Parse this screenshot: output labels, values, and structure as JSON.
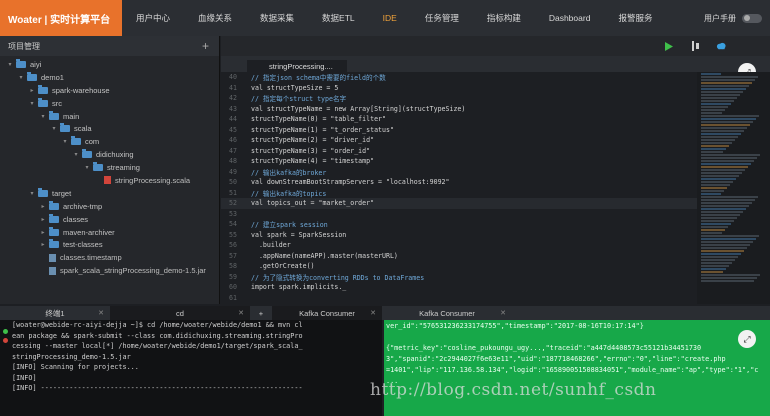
{
  "brand": "Woater | 实时计算平台",
  "nav": {
    "items": [
      "用户中心",
      "血缘关系",
      "数据采集",
      "数据ETL",
      "IDE",
      "任务管理",
      "指标构建",
      "Dashboard",
      "报警服务"
    ],
    "active": "IDE",
    "user_manual": "用户手册"
  },
  "sidebar": {
    "title": "项目管理",
    "add_icon": "plus-icon",
    "tree": [
      {
        "label": "aiyi",
        "depth": 0,
        "type": "folder",
        "caret": "▾"
      },
      {
        "label": "demo1",
        "depth": 1,
        "type": "folder",
        "caret": "▾"
      },
      {
        "label": "spark-warehouse",
        "depth": 2,
        "type": "folder",
        "caret": "▸"
      },
      {
        "label": "src",
        "depth": 2,
        "type": "folder",
        "caret": "▾"
      },
      {
        "label": "main",
        "depth": 3,
        "type": "folder",
        "caret": "▾"
      },
      {
        "label": "scala",
        "depth": 4,
        "type": "folder",
        "caret": "▾"
      },
      {
        "label": "com",
        "depth": 5,
        "type": "folder",
        "caret": "▾"
      },
      {
        "label": "didichuxing",
        "depth": 6,
        "type": "folder",
        "caret": "▾"
      },
      {
        "label": "streaming",
        "depth": 7,
        "type": "folder",
        "caret": "▾"
      },
      {
        "label": "stringProcessing.scala",
        "depth": 8,
        "type": "file-red",
        "caret": ""
      },
      {
        "label": "target",
        "depth": 2,
        "type": "folder",
        "caret": "▾"
      },
      {
        "label": "archive-tmp",
        "depth": 3,
        "type": "folder",
        "caret": "▸"
      },
      {
        "label": "classes",
        "depth": 3,
        "type": "folder",
        "caret": "▸"
      },
      {
        "label": "maven-archiver",
        "depth": 3,
        "type": "folder",
        "caret": "▸"
      },
      {
        "label": "test-classes",
        "depth": 3,
        "type": "folder",
        "caret": "▸"
      },
      {
        "label": "classes.timestamp",
        "depth": 3,
        "type": "file",
        "caret": ""
      },
      {
        "label": "spark_scala_stringProcessing_demo-1.5.jar",
        "depth": 3,
        "type": "file",
        "caret": ""
      }
    ]
  },
  "editor": {
    "tab_label": "stringProcessing....",
    "toolbar_icons": [
      "play-icon",
      "split-icon",
      "cloud-icon"
    ],
    "lines": [
      {
        "n": "40",
        "kind": "comment",
        "text": "// 指定json schema中需要的field的个数"
      },
      {
        "n": "41",
        "kind": "code",
        "text": "val structTypeSize = 5"
      },
      {
        "n": "42",
        "kind": "comment",
        "text": "// 指定每个struct type名字"
      },
      {
        "n": "43",
        "kind": "code",
        "text": "val structTypeName = new Array[String](structTypeSize)"
      },
      {
        "n": "44",
        "kind": "code",
        "text": "structTypeName(0) = \"table_filter\""
      },
      {
        "n": "45",
        "kind": "code",
        "text": "structTypeName(1) = \"t_order_status\""
      },
      {
        "n": "46",
        "kind": "code",
        "text": "structTypeName(2) = \"driver_id\""
      },
      {
        "n": "47",
        "kind": "code",
        "text": "structTypeName(3) = \"order_id\""
      },
      {
        "n": "48",
        "kind": "code",
        "text": "structTypeName(4) = \"timestamp\""
      },
      {
        "n": "49",
        "kind": "comment",
        "text": "// 输出kafka的broker"
      },
      {
        "n": "50",
        "kind": "code",
        "text": "val downStreamBootStrampServers = \"localhost:9092\""
      },
      {
        "n": "51",
        "kind": "comment",
        "text": "// 输出kafka的topics"
      },
      {
        "n": "52",
        "kind": "code",
        "text": "val topics_out = \"market_order\""
      },
      {
        "n": "53",
        "kind": "blank",
        "text": ""
      },
      {
        "n": "54",
        "kind": "comment",
        "text": "// 建立spark session"
      },
      {
        "n": "55",
        "kind": "code",
        "text": "val spark = SparkSession"
      },
      {
        "n": "56",
        "kind": "code",
        "text": "  .builder"
      },
      {
        "n": "57",
        "kind": "code",
        "text": "  .appName(nameAPP).master(masterURL)"
      },
      {
        "n": "58",
        "kind": "code",
        "text": "  .getOrCreate()"
      },
      {
        "n": "59",
        "kind": "comment",
        "text": "// 为了隐式转换为converting RDDs to DataFrames"
      },
      {
        "n": "60",
        "kind": "code",
        "text": "import spark.implicits._"
      },
      {
        "n": "61",
        "kind": "blank",
        "text": ""
      }
    ]
  },
  "bottom": {
    "tabs": [
      "终端1",
      "cd",
      "+",
      "Kafka Consumer",
      "Kafka Consumer"
    ],
    "console_lines": [
      "[woater@webide-rc-aiyi-dejja ~]$ cd /home/woater/webide/demo1 && mvn cl",
      "ean package && spark-submit --class com.didichuxing.streaming.stringPro",
      "cessing --master local[*] /home/woater/webide/demo1/target/spark_scala_",
      "stringProcessing_demo-1.5.jar",
      "[INFO] Scanning for projects...",
      "[INFO]",
      "[INFO] ----------------------------------------------------------------"
    ],
    "kafka_lines": [
      "ver_id\":\"576531236233174755\",\"timestamp\":\"2017-08-16T10:17:14\"}",
      "",
      "{\"metric_key\":\"cosline_pukoungu_ugy...,\"traceid\":\"a447d4408573c55121b34451730",
      "3\",\"spanid\":\"2c2944027f6e63e11\",\"uid\":\"187718468266\",\"errno\":\"0\",\"line\":\"create.php",
      "=1401\",\"lip\":\"117.136.58.134\",\"logid\":\"165890051508834051\",\"module_name\":\"ap\",\"type\":\"1\",\"c",
      "..."
    ]
  },
  "watermark": "http://blog.csdn.net/sunhf_csdn"
}
